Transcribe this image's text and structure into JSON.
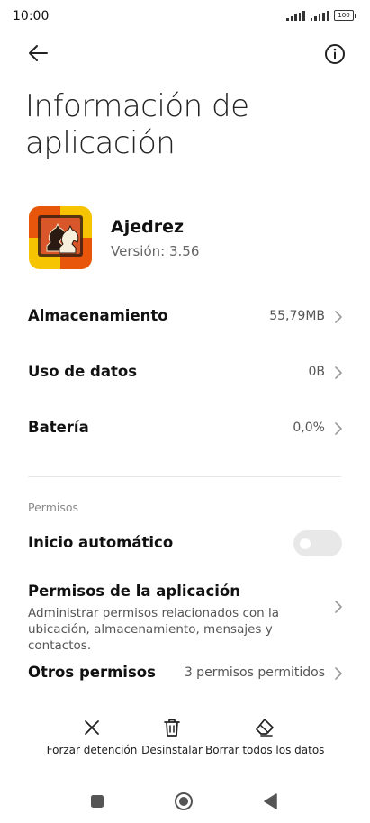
{
  "status_bar": {
    "time": "10:00",
    "battery": "100"
  },
  "toolbar": {
    "back_icon": "arrow-left-icon",
    "info_icon": "info-icon"
  },
  "page": {
    "title": "Información de aplicación"
  },
  "app": {
    "name": "Ajedrez",
    "version": "Versión: 3.56",
    "icon": "chess-knight-icon",
    "icon_colors": [
      "#e8560c",
      "#f6c400"
    ]
  },
  "info_rows": [
    {
      "label": "Almacenamiento",
      "value": "55,79MB"
    },
    {
      "label": "Uso de datos",
      "value": "0B"
    },
    {
      "label": "Batería",
      "value": "0,0%"
    }
  ],
  "permissions": {
    "section_label": "Permisos",
    "autostart": {
      "label": "Inicio automático",
      "enabled": false
    },
    "app_permissions": {
      "title": "Permisos de la aplicación",
      "description": "Administrar permisos relacionados con la ubicación, almacenamiento, mensajes y contactos."
    },
    "other": {
      "label": "Otros permisos",
      "value": "3 permisos permitidos"
    }
  },
  "actions": [
    {
      "label": "Forzar detención",
      "icon": "close-icon"
    },
    {
      "label": "Desinstalar",
      "icon": "trash-icon"
    },
    {
      "label": "Borrar todos los datos",
      "icon": "eraser-icon"
    }
  ],
  "nav": {
    "recents_icon": "square-icon",
    "home_icon": "circle-icon",
    "back_icon": "triangle-back-icon"
  }
}
